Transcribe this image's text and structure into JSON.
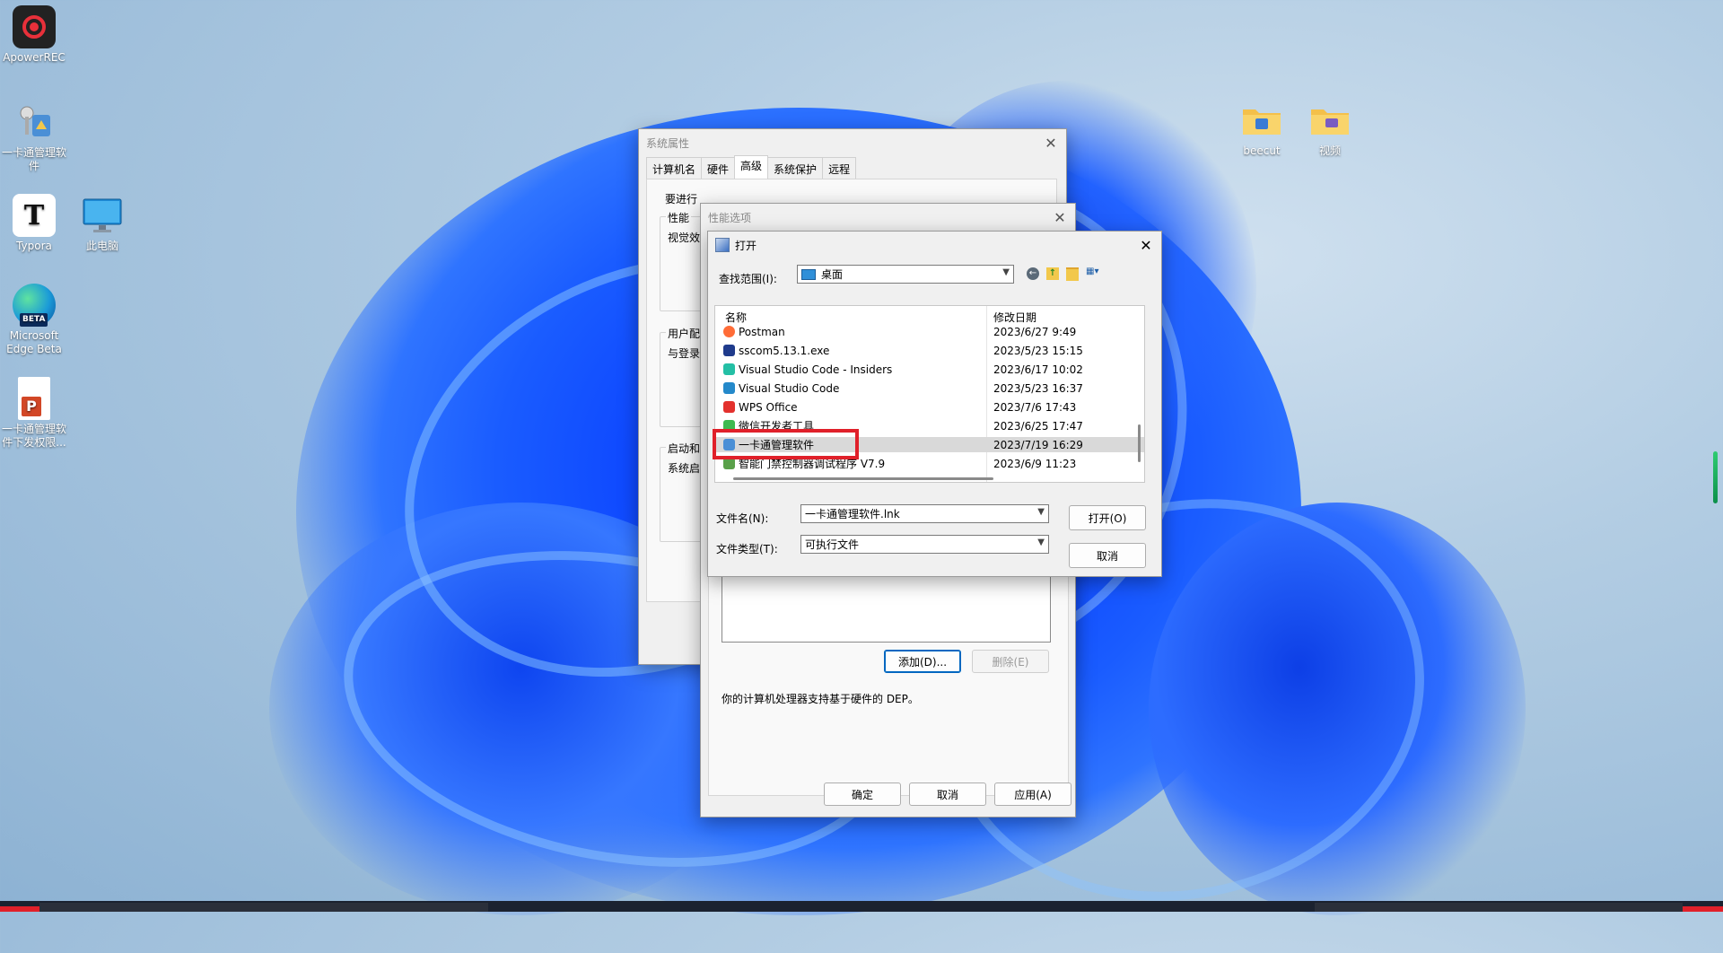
{
  "desktop": {
    "icons": [
      {
        "label": "ApowerREC",
        "icon": "apowerrec-icon"
      },
      {
        "label": "一卡通管理软件",
        "icon": "software-shortcut-icon"
      },
      {
        "label": "Typora",
        "icon": "typora-icon"
      },
      {
        "label": "此电脑",
        "icon": "monitor-icon"
      },
      {
        "label": "Microsoft Edge Beta",
        "icon": "edge-beta-icon"
      },
      {
        "label": "一卡通管理软件下发权限...",
        "icon": "ppt-file-icon"
      },
      {
        "label": "beecut",
        "icon": "folder-icon"
      },
      {
        "label": "视频",
        "icon": "folder-icon"
      }
    ],
    "typora_letter": "T",
    "edge_badge": "BETA",
    "ppt_letter": "P"
  },
  "system_properties": {
    "title": "系统属性",
    "tabs": [
      "计算机名",
      "硬件",
      "高级",
      "系统保护",
      "远程"
    ],
    "active_tab": "高级",
    "intro_fragment": "要进行",
    "group_performance": "性能",
    "perf_text": "视觉效",
    "group_user": "用户配",
    "user_text": "与登录",
    "group_startup": "启动和",
    "startup_text": "系统启"
  },
  "performance_options": {
    "title": "性能选项",
    "add_button": "添加(D)...",
    "delete_button": "删除(E)",
    "dep_note": "你的计算机处理器支持基于硬件的 DEP。",
    "ok_button": "确定",
    "cancel_button": "取消",
    "apply_button": "应用(A)"
  },
  "open_dialog": {
    "title": "打开",
    "lookin_label": "查找范围(I):",
    "lookin_value": "桌面",
    "col_name": "名称",
    "col_date": "修改日期",
    "files": [
      {
        "name": "Postman",
        "date": "2023/6/27 9:49",
        "icon": "postman-icon",
        "color": "#ff6c37"
      },
      {
        "name": "sscom5.13.1.exe",
        "date": "2023/5/23 15:15",
        "icon": "exe-icon",
        "color": "#1f3b8c"
      },
      {
        "name": "Visual Studio Code - Insiders",
        "date": "2023/6/17 10:02",
        "icon": "vscode-insiders-icon",
        "color": "#24bfa5"
      },
      {
        "name": "Visual Studio Code",
        "date": "2023/5/23 16:37",
        "icon": "vscode-icon",
        "color": "#2489ca"
      },
      {
        "name": "WPS Office",
        "date": "2023/7/6 17:43",
        "icon": "wps-icon",
        "color": "#e3312d"
      },
      {
        "name": "微信开发者工具",
        "date": "2023/6/25 17:47",
        "icon": "wechat-devtools-icon",
        "color": "#3fb950"
      },
      {
        "name": "一卡通管理软件",
        "date": "2023/7/19 16:29",
        "icon": "software-shortcut-icon",
        "color": "#4a8fd6"
      },
      {
        "name": "智能门禁控制器调试程序 V7.9",
        "date": "2023/6/9 11:23",
        "icon": "app-icon",
        "color": "#5aa04a"
      }
    ],
    "selected_index": 6,
    "filename_label": "文件名(N):",
    "filename_value": "一卡通管理软件.lnk",
    "filetype_label": "文件类型(T):",
    "filetype_value": "可执行文件",
    "open_button": "打开(O)",
    "cancel_button": "取消"
  },
  "highlight_color": "#e0202a"
}
